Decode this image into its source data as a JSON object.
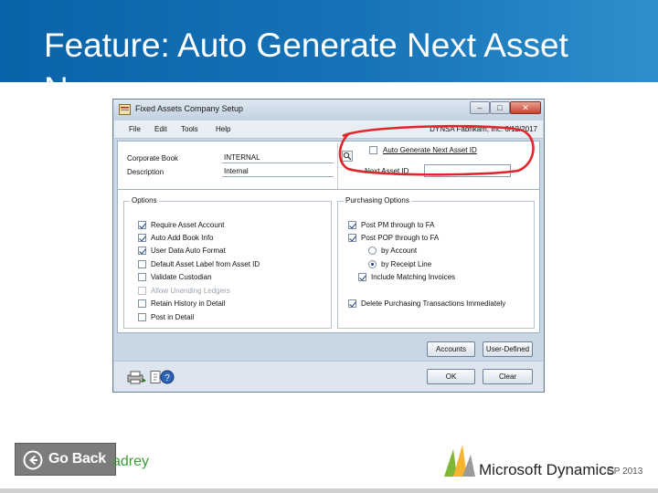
{
  "slide": {
    "title": "Feature: Auto Generate Next Asset No."
  },
  "window": {
    "title": "Fixed Assets Company Setup",
    "minimize": "–",
    "maximize": "□",
    "close": "✕",
    "menu": [
      "File",
      "Edit",
      "Tools",
      "Help"
    ],
    "company_date": "DYNSA  Fabrikam, Inc.  6/12/2017",
    "fields": {
      "corporate_book_label": "Corporate Book",
      "corporate_book_value": "INTERNAL",
      "description_label": "Description",
      "description_value": "Internal",
      "auto_generate_label": "Auto Generate Next Asset ID",
      "next_asset_label": "Next Asset ID"
    },
    "options": {
      "title": "Options",
      "items": [
        {
          "label": "Require Asset Account",
          "checked": true,
          "disabled": false
        },
        {
          "label": "Auto Add Book Info",
          "checked": true,
          "disabled": false
        },
        {
          "label": "User Data Auto Format",
          "checked": true,
          "disabled": false
        },
        {
          "label": "Default Asset Label from Asset ID",
          "checked": false,
          "disabled": false
        },
        {
          "label": "Validate Custodian",
          "checked": false,
          "disabled": false
        },
        {
          "label": "Allow Unending Ledgers",
          "checked": false,
          "disabled": true
        },
        {
          "label": "Retain History in Detail",
          "checked": false,
          "disabled": false
        },
        {
          "label": "Post in Detail",
          "checked": false,
          "disabled": false
        }
      ]
    },
    "purchasing": {
      "title": "Purchasing Options",
      "post_pm": "Post PM through to FA",
      "post_pop": "Post POP through to FA",
      "by_account": "by Account",
      "by_receipt": "by Receipt Line",
      "include_matching": "Include Matching Invoices",
      "delete_purchasing": "Delete Purchasing Transactions Immediately"
    },
    "buttons": {
      "accounts": "Accounts",
      "user_defined": "User-Defined",
      "ok": "OK",
      "clear": "Clear"
    }
  },
  "footer": {
    "go_back": "Go Back",
    "left_brand": "adrey",
    "ms_text": "Microsoft Dynamics",
    "ms_version": "GP 2013"
  },
  "colors": {
    "banner": "#0a63a8",
    "highlight": "#e0262b",
    "brand_green": "#3d9c39"
  }
}
